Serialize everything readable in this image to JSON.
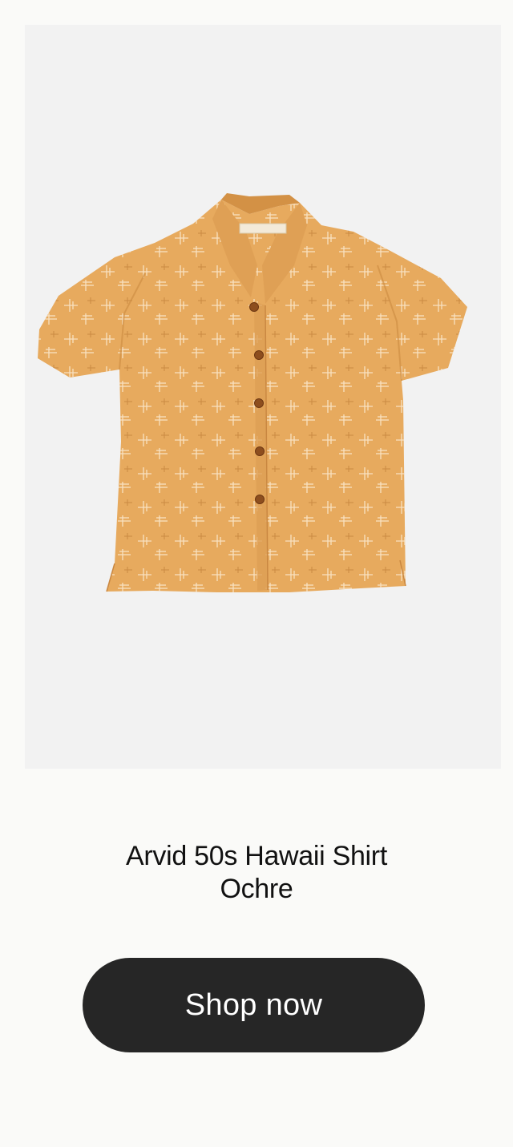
{
  "product": {
    "name": "Arvid 50s Hawaii Shirt Ochre",
    "image_alt": "Arvid 50s Hawaii Shirt Ochre",
    "colors": {
      "shirt": "#e7aa5e",
      "shirt_shadow": "#d8974a",
      "image_background": "#f2f2f2",
      "button_background": "#262626",
      "button_text": "#ffffff"
    }
  },
  "cta": {
    "label": "Shop now"
  }
}
